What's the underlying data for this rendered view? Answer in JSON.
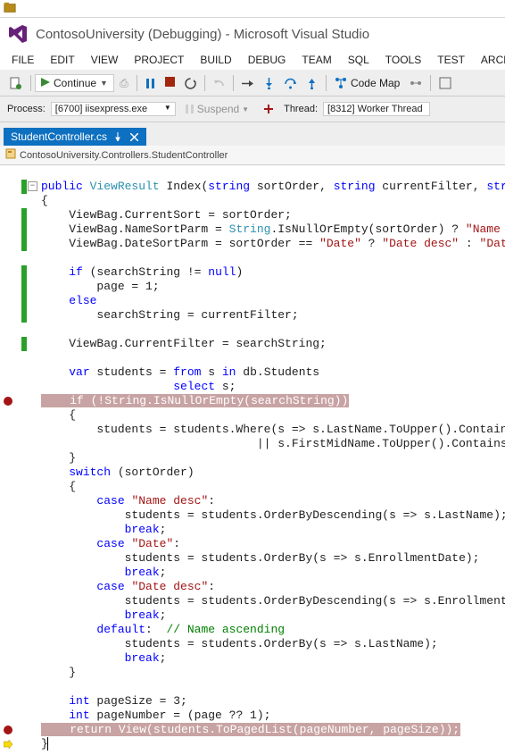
{
  "title": "ContosoUniversity (Debugging) - Microsoft Visual Studio",
  "menus": {
    "file": "FILE",
    "edit": "EDIT",
    "view": "VIEW",
    "project": "PROJECT",
    "build": "BUILD",
    "debug": "DEBUG",
    "team": "TEAM",
    "sql": "SQL",
    "tools": "TOOLS",
    "test": "TEST",
    "architect": "ARCHITECT"
  },
  "toolbar": {
    "continue": "Continue",
    "codemap": "Code Map"
  },
  "process_row": {
    "process_label": "Process:",
    "process_value": "[6700] iisexpress.exe",
    "suspend": "Suspend",
    "thread_label": "Thread:",
    "thread_value": "[8312] Worker Thread"
  },
  "tab": {
    "name": "StudentController.cs"
  },
  "breadcrumb": "ContosoUniversity.Controllers.StudentController",
  "code_lines": [
    "public ViewResult Index(string sortOrder, string currentFilter, string sea",
    "{",
    "    ViewBag.CurrentSort = sortOrder;",
    "    ViewBag.NameSortParm = String.IsNullOrEmpty(sortOrder) ? \"Name desc\" :",
    "    ViewBag.DateSortParm = sortOrder == \"Date\" ? \"Date desc\" : \"Date\";",
    "",
    "    if (searchString != null)",
    "        page = 1;",
    "    else",
    "        searchString = currentFilter;",
    "",
    "    ViewBag.CurrentFilter = searchString;",
    "",
    "    var students = from s in db.Students",
    "                   select s;",
    "    if (!String.IsNullOrEmpty(searchString))",
    "    {",
    "        students = students.Where(s => s.LastName.ToUpper().Contains(searc",
    "                               || s.FirstMidName.ToUpper().Contains(search",
    "    }",
    "    switch (sortOrder)",
    "    {",
    "        case \"Name desc\":",
    "            students = students.OrderByDescending(s => s.LastName);",
    "            break;",
    "        case \"Date\":",
    "            students = students.OrderBy(s => s.EnrollmentDate);",
    "            break;",
    "        case \"Date desc\":",
    "            students = students.OrderByDescending(s => s.EnrollmentDate);",
    "            break;",
    "        default:  // Name ascending",
    "            students = students.OrderBy(s => s.LastName);",
    "            break;",
    "    }",
    "",
    "    int pageSize = 3;",
    "    int pageNumber = (page ?? 1);",
    "    return View(students.ToPagedList(pageNumber, pageSize));",
    "}"
  ],
  "gutter": {
    "breakpoint_lines": [
      15,
      38
    ],
    "yellow_arrow_line": 39,
    "collapse_line": 0,
    "green_mark_ranges": [
      [
        0,
        0
      ],
      [
        2,
        4
      ],
      [
        6,
        9
      ],
      [
        11,
        11
      ]
    ]
  }
}
